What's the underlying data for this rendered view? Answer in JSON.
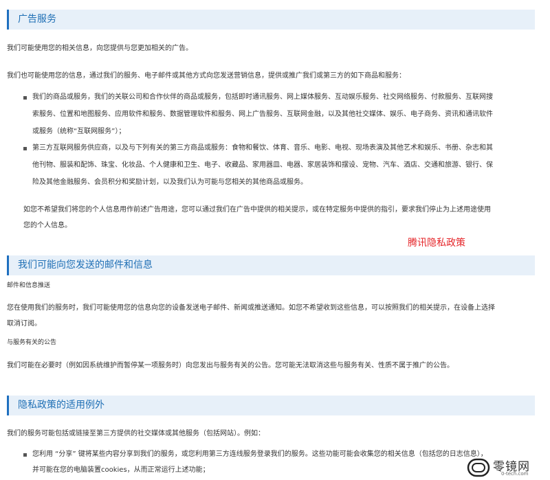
{
  "sections": {
    "ads": {
      "title": "广告服务",
      "p1": "我们可能使用您的相关信息，向您提供与您更加相关的广告。",
      "p2": "我们也可能使用您的信息，通过我们的服务、电子邮件或其他方式向您发送营销信息，提供或推广我们或第三方的如下商品和服务：",
      "bullet1": [
        "我们的商品或服务，我们的关联公司和合作伙伴的商品或服务，包括即时通讯服务、网上媒体服务、互动娱乐服务、社交网络服务、付款服务、互联网搜",
        "索服务、位置和地图服务、应用软件和服务、数据管理软件和服务、网上广告服务、互联网金融，以及其他社交媒体、娱乐、电子商务、资讯和通讯软件",
        "或服务（统称“互联网服务”）；"
      ],
      "bullet2": [
        "第三方互联网服务供应商，以及与下列有关的第三方商品或服务：食物和餐饮、体育、音乐、电影、电视、现场表演及其他艺术和娱乐、书册、杂志和其",
        "他刊物、服装和配饰、珠宝、化妆品、个人健康和卫生、电子、收藏品、家用器皿、电器、家居装饰和摆设、宠物、汽车、酒店、交通和旅游、银行、保",
        "险及其他金融服务、会员积分和奖励计划，以及我们认为可能与您相关的其他商品或服务。"
      ],
      "p3": [
        "如您不希望我们将您的个人信息用作前述广告用途，您可以通过我们在广告中提供的相关提示，或在特定服务中提供的指引，要求我们停止为上述用途使用",
        "您的个人信息。"
      ]
    },
    "annotation": "腾讯隐私政策",
    "mail": {
      "title": "我们可能向您发送的邮件和信息",
      "sub1": "邮件和信息推送",
      "p1": [
        "您在使用我们的服务时，我们可能使用您的信息向您的设备发送电子邮件、新闻或推送通知。如您不希望收到这些信息，可以按照我们的相关提示，在设备上选择",
        "取消订阅。"
      ],
      "sub2": "与服务有关的公告",
      "p2": "我们可能在必要时（例如因系统维护而暂停某一项服务时）向您发出与服务有关的公告。您可能无法取消这些与服务有关、性质不属于推广的公告。"
    },
    "exceptions": {
      "title": "隐私政策的适用例外",
      "p1": "我们的服务可能包括或链接至第三方提供的社交媒体或其他服务（包括网站）。例如：",
      "bullet1": [
        "您利用 “分享” 键将某些内容分享到我们的服务，或您利用第三方连线服务登录我们的服务。这些功能可能会收集您的相关信息（包括您的日志信息），",
        "并可能在您的电脑装置cookies，从而正常运行上述功能；"
      ]
    }
  },
  "watermark": {
    "brand": "零镜网",
    "site": "0-tech.com"
  },
  "colors": {
    "header_bg": "#e7f0f9",
    "header_bar": "#1e6fbf",
    "title": "#1f6fb5",
    "annotation": "#e5262a"
  }
}
